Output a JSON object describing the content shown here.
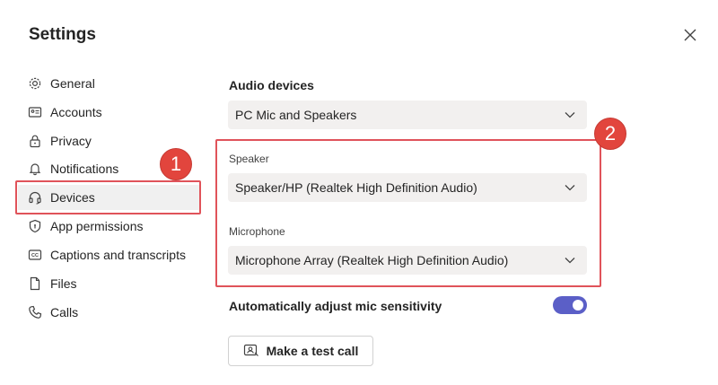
{
  "dialog": {
    "title": "Settings",
    "close_icon": "close-icon"
  },
  "nav": {
    "items": [
      {
        "label": "General",
        "icon": "gear-icon"
      },
      {
        "label": "Accounts",
        "icon": "id-card-icon"
      },
      {
        "label": "Privacy",
        "icon": "lock-icon"
      },
      {
        "label": "Notifications",
        "icon": "bell-icon"
      },
      {
        "label": "Devices",
        "icon": "headset-icon",
        "active": true
      },
      {
        "label": "App permissions",
        "icon": "shield-icon"
      },
      {
        "label": "Captions and transcripts",
        "icon": "cc-icon"
      },
      {
        "label": "Files",
        "icon": "file-icon"
      },
      {
        "label": "Calls",
        "icon": "phone-icon"
      }
    ]
  },
  "annotations": {
    "badge1": "1",
    "badge2": "2",
    "highlight_color": "#e0535a"
  },
  "audio": {
    "section_label": "Audio devices",
    "device_value": "PC Mic and Speakers",
    "speaker_label": "Speaker",
    "speaker_value": "Speaker/HP (Realtek High Definition Audio)",
    "mic_label": "Microphone",
    "mic_value": "Microphone Array (Realtek High Definition Audio)"
  },
  "auto_adjust": {
    "label": "Automatically adjust mic sensitivity",
    "enabled": true,
    "accent": "#5b5fc7"
  },
  "test_call": {
    "label": "Make a test call",
    "icon": "test-call-icon"
  }
}
